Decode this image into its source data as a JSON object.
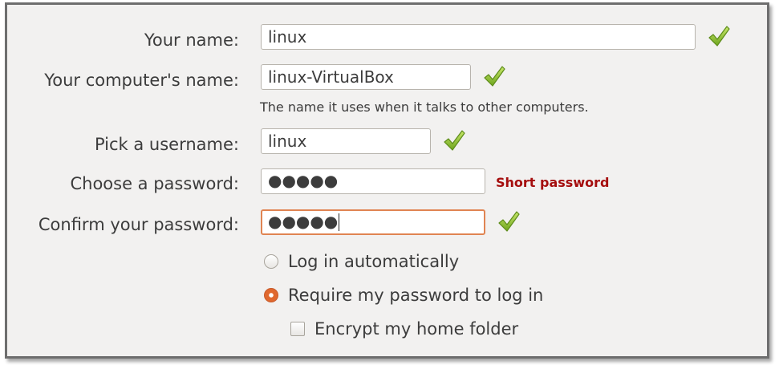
{
  "form": {
    "your_name": {
      "label": "Your name:",
      "value": "linux",
      "valid": true
    },
    "computer_name": {
      "label": "Your computer's name:",
      "value": "linux-VirtualBox",
      "valid": true,
      "hint": "The name it uses when it talks to other computers."
    },
    "username": {
      "label": "Pick a username:",
      "value": "linux",
      "valid": true
    },
    "password": {
      "label": "Choose a password:",
      "value": "●●●●●",
      "strength_message": "Short password"
    },
    "confirm_password": {
      "label": "Confirm your password:",
      "value": "●●●●●",
      "valid": true,
      "focused": true
    },
    "login_options": [
      {
        "label": "Log in automatically",
        "selected": false
      },
      {
        "label": "Require my password to log in",
        "selected": true
      }
    ],
    "encrypt_home": {
      "label": "Encrypt my home folder",
      "checked": false
    }
  },
  "colors": {
    "panel_bg": "#f2f1f0",
    "focus_border": "#e08452",
    "radio_selected": "#e0682e",
    "warning_text": "#a50e0e",
    "check_green": "#7cb62c"
  },
  "icons": {
    "valid": "checkmark-icon",
    "radio": "radio-button",
    "checkbox": "checkbox"
  }
}
